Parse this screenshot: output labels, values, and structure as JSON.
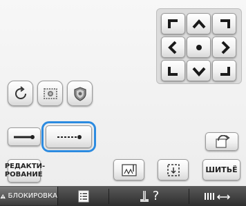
{
  "pad": {
    "icons": [
      "corner-top-left-icon",
      "arrow-up-icon",
      "corner-top-right-icon",
      "arrow-left-icon",
      "center-dot-icon",
      "arrow-right-icon",
      "corner-bottom-left-icon",
      "arrow-down-icon",
      "corner-bottom-right-icon"
    ]
  },
  "tools": {
    "rotate_icon": "rotate-icon",
    "frame_icon": "frame-pattern-icon",
    "shield_icon": "shield-pattern-icon"
  },
  "stitch": {
    "left_icon": "stitch-line-thick-icon",
    "right_icon": "stitch-line-dotted-icon"
  },
  "buttons": {
    "edit_label_line1": "РЕДАКТИ-",
    "edit_label_line2": "РОВАНИЕ",
    "sew_label": "ШИТЬЁ"
  },
  "bottom": {
    "lock_label": "БЛОКИРОВКА",
    "help_glyph": "?"
  },
  "colors": {
    "selection": "#2c8be0",
    "pad_arrow": "#1a1a1a",
    "bar_bg": "#3a3a3a"
  }
}
